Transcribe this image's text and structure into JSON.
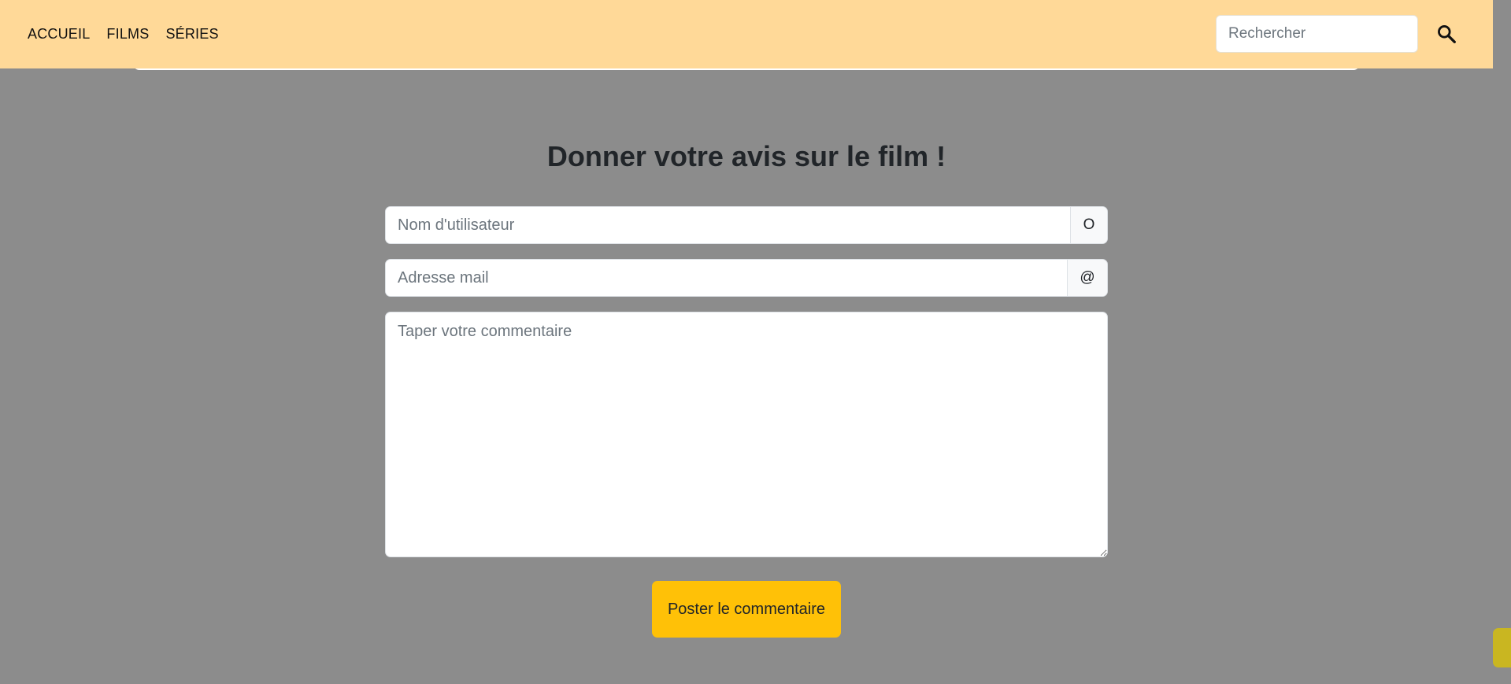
{
  "nav": {
    "links": [
      "ACCUEIL",
      "FILMS",
      "SÉRIES"
    ],
    "search_placeholder": "Rechercher",
    "search_icon": "magnifier-icon"
  },
  "form": {
    "title": "Donner votre avis sur le film !",
    "username_placeholder": "Nom d'utilisateur",
    "username_addon": "O",
    "email_placeholder": "Adresse mail",
    "email_addon": "@",
    "comment_placeholder": "Taper votre commentaire",
    "submit_label": "Poster le commentaire"
  },
  "colors": {
    "navbar": "#ffd998",
    "background": "#8c8c8c",
    "submit": "#ffc107",
    "side_tab": "#c9b621"
  }
}
